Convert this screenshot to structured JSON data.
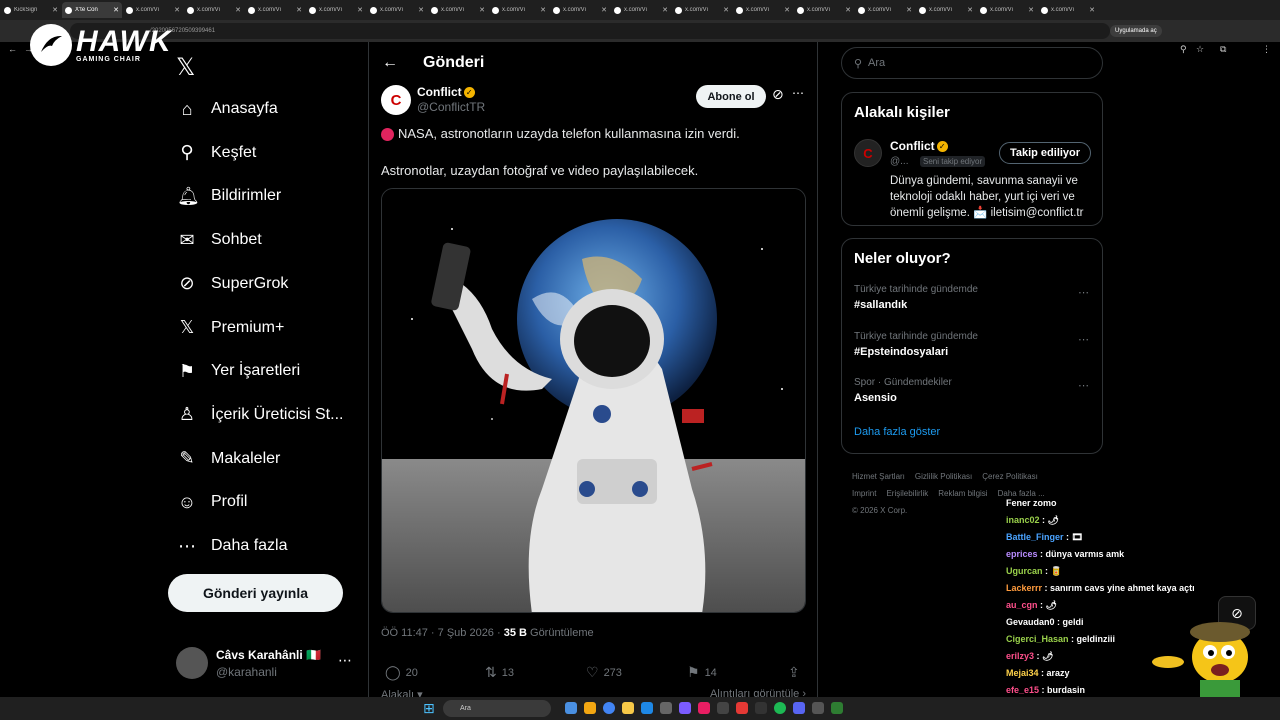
{
  "browser": {
    "tabs": [
      "KickSign",
      "X'te Con",
      "x.com/Vi",
      "x.com/Vi",
      "x.com/Vi",
      "x.com/Vi",
      "x.com/Vi",
      "x.com/Vi",
      "x.com/Vi",
      "x.com/Vi",
      "x.com/Vi",
      "x.com/Vi",
      "x.com/Vi",
      "x.com/Vi",
      "x.com/Vi",
      "x.com/Vi",
      "x.com/Vi",
      "x.com/Vi"
    ],
    "url": "/2020056720509399461",
    "open_app": "Uygulamada aç"
  },
  "overlay_logo": {
    "big": "HAWK",
    "small": "GAMING CHAIR"
  },
  "nav": {
    "items": [
      {
        "icon": "⌂",
        "label": "Anasayfa"
      },
      {
        "icon": "⚲",
        "label": "Keşfet"
      },
      {
        "icon": "🔔︎",
        "label": "Bildirimler"
      },
      {
        "icon": "✉",
        "label": "Sohbet"
      },
      {
        "icon": "⊘",
        "label": "SuperGrok"
      },
      {
        "icon": "𝕏",
        "label": "Premium+"
      },
      {
        "icon": "⚑",
        "label": "Yer İşaretleri"
      },
      {
        "icon": "♙",
        "label": "İçerik Üreticisi St..."
      },
      {
        "icon": "✎",
        "label": "Makaleler"
      },
      {
        "icon": "☺",
        "label": "Profil"
      },
      {
        "icon": "⋯",
        "label": "Daha fazla"
      }
    ],
    "post_button": "Gönderi yayınla",
    "account": {
      "name": "Câvs Karahânli 🇮🇹",
      "handle": "@karahanli"
    }
  },
  "post": {
    "header_title": "Gönderi",
    "author_name": "Conflict",
    "author_handle": "@ConflictTR",
    "subscribe": "Abone ol",
    "line1": "NASA, astronotların uzayda telefon kullanmasına izin verdi.",
    "line2": "Astronotlar, uzaydan fotoğraf ve video paylaşılabilecek.",
    "time": "ÖÖ 11:47 · 7 Şub 2026 · ",
    "views_count": "35 B",
    "views_label": " Görüntüleme",
    "stats": {
      "replies": "20",
      "reposts": "13",
      "likes": "273",
      "bookmarks": "14"
    },
    "tabs_left": "Alakalı ▾",
    "tabs_right": "Alıntıları görüntüle ›"
  },
  "right": {
    "search_placeholder": "Ara",
    "related_title": "Alakalı kişiler",
    "related": {
      "name": "Conflict",
      "handle": "@...",
      "follows_you": "Seni takip ediyor",
      "follow_button": "Takip ediliyor",
      "bio": "Dünya gündemi, savunma sanayii ve teknoloji odaklı haber, yurt içi veri ve önemli gelişme. 📩 iletisim@conflict.tr"
    },
    "trends_title": "Neler oluyor?",
    "trends": [
      {
        "context": "Türkiye tarihinde gündemde",
        "name": "#sallandık"
      },
      {
        "context": "Türkiye tarihinde gündemde",
        "name": "#Epsteindosyalari"
      },
      {
        "context": "Spor · Gündemdekiler",
        "name": "Asensio"
      }
    ],
    "show_more": "Daha fazla göster",
    "footer": [
      "Hizmet Şartları",
      "Gizlilik Politikası",
      "Çerez Politikası",
      "Imprint",
      "Erişilebilirlik",
      "Reklam bilgisi",
      "Daha fazla ...",
      "© 2026 X Corp."
    ]
  },
  "chat": [
    {
      "user": "",
      "color": "#ffffff",
      "msg": "Fener zomo"
    },
    {
      "user": "inanc02",
      "color": "#9ad14b",
      "msg": "🌶"
    },
    {
      "user": "Battle_Finger",
      "color": "#4aa3ff",
      "msg": "🎞"
    },
    {
      "user": "eprices",
      "color": "#b98cff",
      "msg": "dünya varmıs amk"
    },
    {
      "user": "Ugurcan",
      "color": "#9ad14b",
      "msg": "🥫"
    },
    {
      "user": "Lackerrr",
      "color": "#ff9b3d",
      "msg": "sanırım cavs yine ahmet kaya açtı"
    },
    {
      "user": "au_cgn",
      "color": "#ff4f8b",
      "msg": "🌶"
    },
    {
      "user": "Gevaudan0",
      "color": "#ffffff",
      "msg": "geldi"
    },
    {
      "user": "Cigerci_Hasan",
      "color": "#9ad14b",
      "msg": "geldinziii"
    },
    {
      "user": "erilzy3",
      "color": "#ff4f8b",
      "msg": "🌶"
    },
    {
      "user": "Mejai34",
      "color": "#ffd24a",
      "msg": "arazy"
    },
    {
      "user": "efe_e15",
      "color": "#ff4f8b",
      "msg": "burdasin"
    },
    {
      "user": "erilzy3",
      "color": "#ff4f8b",
      "msg": "🌶"
    }
  ],
  "taskbar": {
    "search": "Ara",
    "time": "",
    "date": ""
  }
}
